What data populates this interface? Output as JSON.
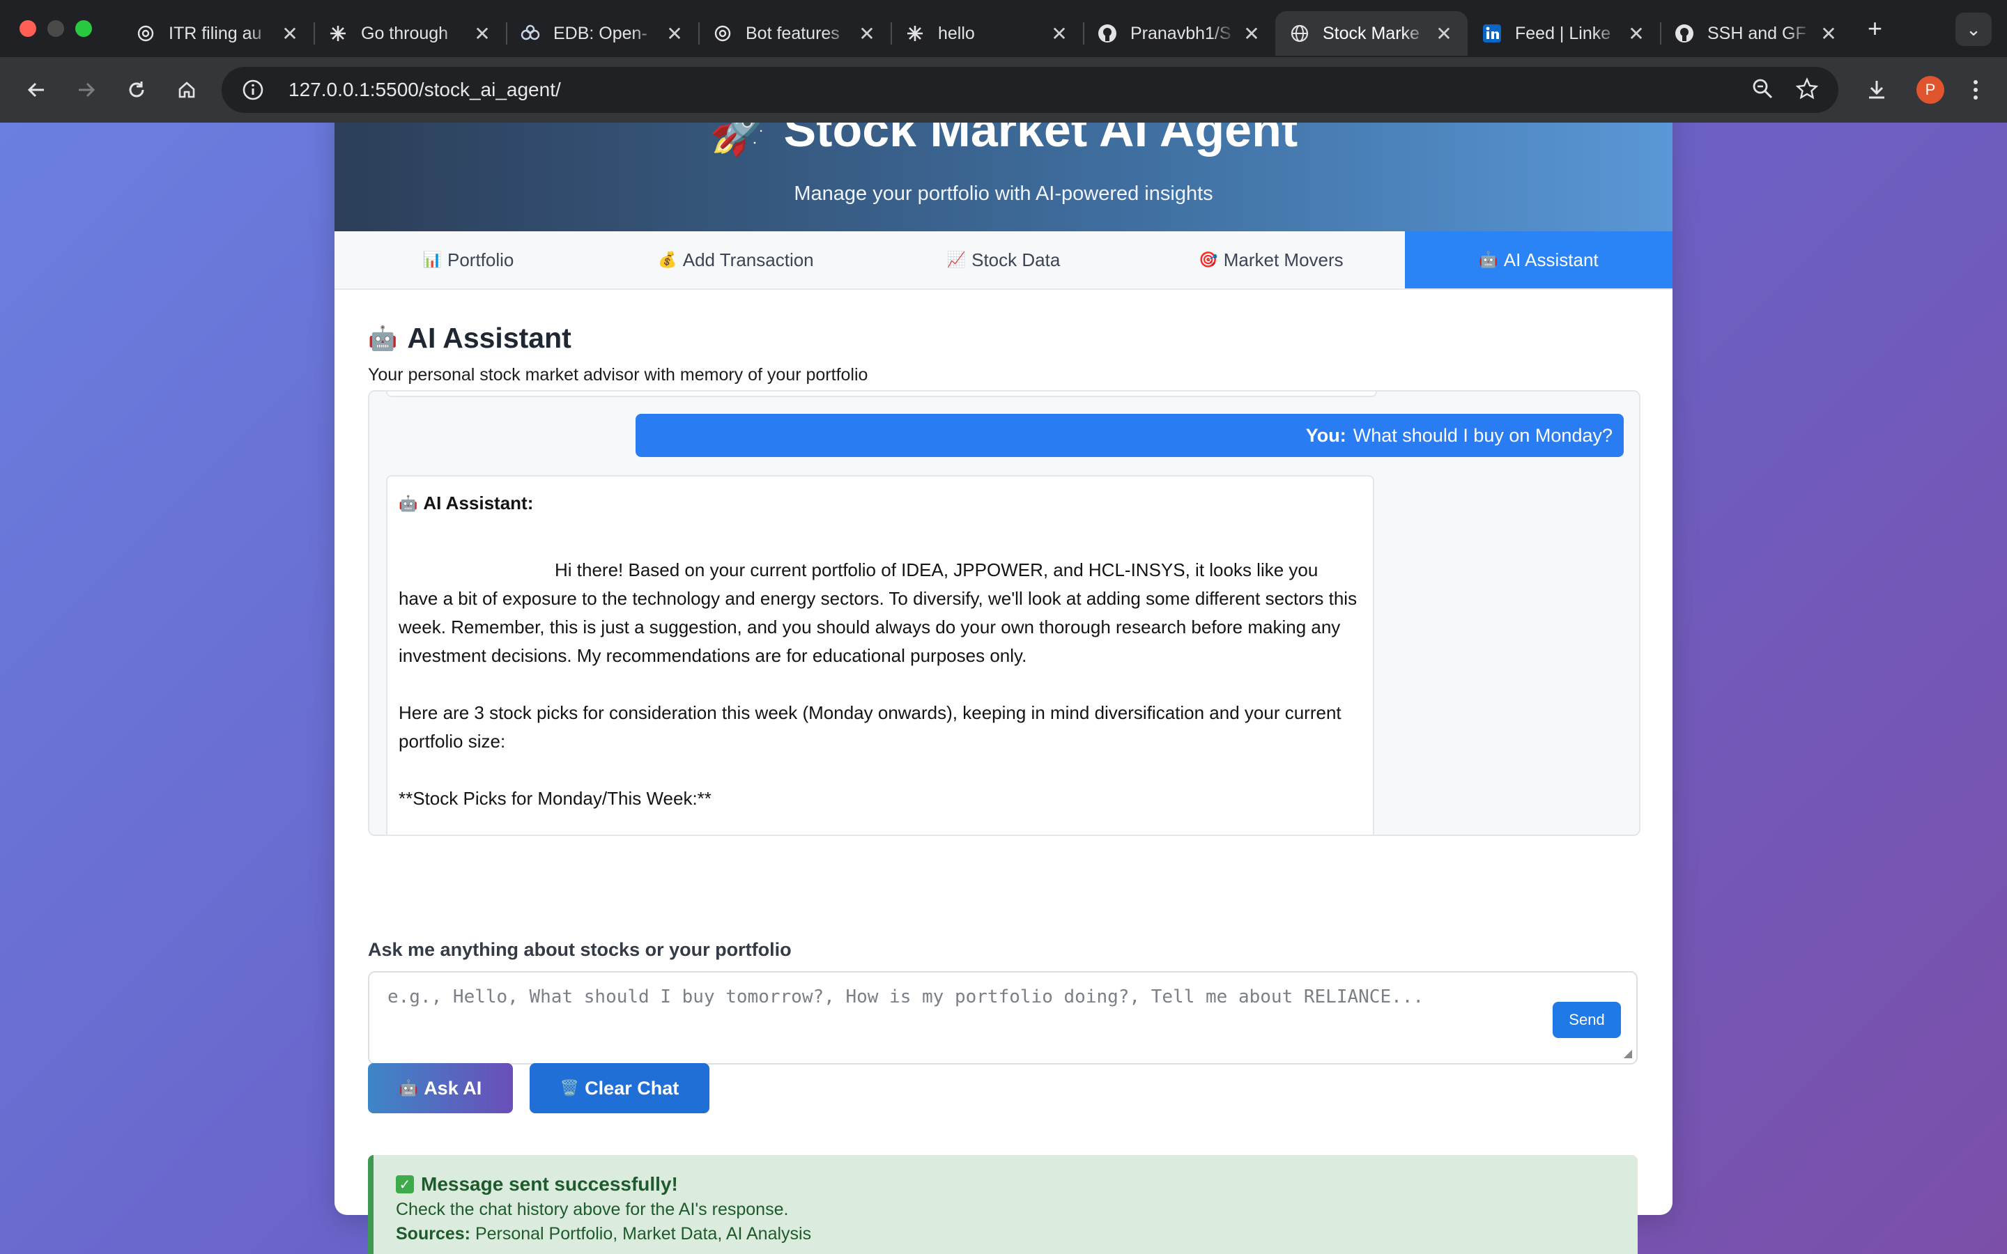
{
  "browser": {
    "tabs": [
      {
        "title": "ITR filing au",
        "icon": "openai-icon",
        "active": false
      },
      {
        "title": "Go through",
        "icon": "claude-icon",
        "active": false
      },
      {
        "title": "EDB: Open-",
        "icon": "edb-icon",
        "active": false
      },
      {
        "title": "Bot features",
        "icon": "openai-icon",
        "active": false
      },
      {
        "title": "hello",
        "icon": "claude-icon",
        "active": false
      },
      {
        "title": "Pranavbh1/S",
        "icon": "github-icon",
        "active": false
      },
      {
        "title": "Stock Marke",
        "icon": "globe-icon",
        "active": true
      },
      {
        "title": "Feed | Linke",
        "icon": "linkedin-icon",
        "active": false
      },
      {
        "title": "SSH and GF",
        "icon": "github-icon",
        "active": false
      }
    ],
    "url": "127.0.0.1:5500/stock_ai_agent/",
    "profile_initial": "P"
  },
  "hero": {
    "emoji": "🚀",
    "title": "Stock Market AI Agent",
    "subtitle": "Manage your portfolio with AI-powered insights"
  },
  "nav": [
    {
      "emoji": "📊",
      "label": "Portfolio"
    },
    {
      "emoji": "💰",
      "label": "Add Transaction"
    },
    {
      "emoji": "📈",
      "label": "Stock Data"
    },
    {
      "emoji": "🎯",
      "label": "Market Movers"
    },
    {
      "emoji": "🤖",
      "label": "AI Assistant"
    }
  ],
  "section": {
    "emoji": "🤖",
    "title": "AI Assistant",
    "subtitle": "Your personal stock market advisor with memory of your portfolio"
  },
  "chat": {
    "user_prefix": "You:",
    "user_text": "What should I buy on Monday?",
    "ai_emoji": "🤖",
    "ai_label": "AI Assistant:",
    "ai_p1": "Hi there!  Based on your current portfolio of IDEA, JPPOWER, and HCL-INSYS, it looks like you have a bit of exposure to the technology and energy sectors.  To diversify, we'll look at adding some different sectors this week.  Remember, this is just a suggestion, and you should always do your own thorough research before making any investment decisions.  My recommendations are for educational purposes only.",
    "ai_p2": "Here are 3 stock picks for consideration this week (Monday onwards), keeping in mind diversification and your current portfolio size:",
    "ai_p3": "**Stock Picks for Monday/This Week:**"
  },
  "ask": {
    "label": "Ask me anything about stocks or your portfolio",
    "placeholder": "e.g., Hello, What should I buy tomorrow?, How is my portfolio doing?, Tell me about RELIANCE...",
    "send_label": "Send"
  },
  "buttons": {
    "ask_emoji": "🤖",
    "ask_label": "Ask AI",
    "clear_emoji": "🗑️",
    "clear_label": "Clear Chat"
  },
  "alert": {
    "check": "✓",
    "title": "Message sent successfully!",
    "line1": "Check the chat history above for the AI's response.",
    "sources_label": "Sources:",
    "sources": "Personal Portfolio, Market Data, AI Analysis"
  },
  "colors": {
    "accent": "#2a84f5",
    "success_bg": "#dbecdf",
    "success_border": "#3d9a4f"
  }
}
